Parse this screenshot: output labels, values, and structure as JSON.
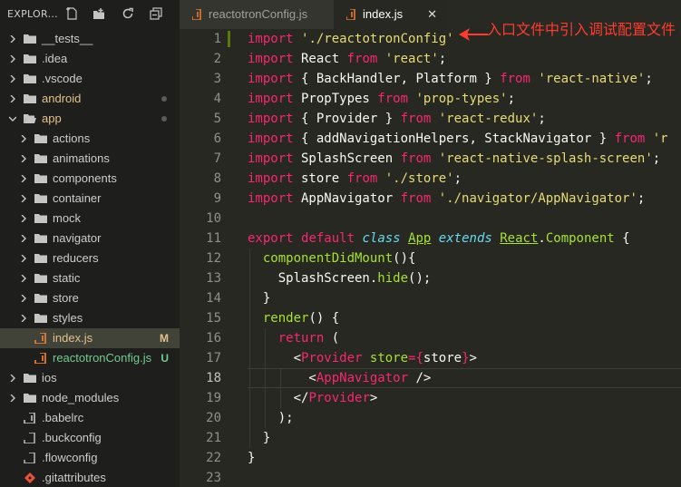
{
  "explorer": {
    "title": "EXPLOR...",
    "icons": [
      "new-file-icon",
      "new-folder-icon",
      "refresh-icon",
      "collapse-all-icon"
    ]
  },
  "tree": [
    {
      "label": "__tests__",
      "kind": "folder",
      "depth": 0,
      "expanded": false
    },
    {
      "label": ".idea",
      "kind": "folder",
      "depth": 0,
      "expanded": false
    },
    {
      "label": ".vscode",
      "kind": "folder",
      "depth": 0,
      "expanded": false
    },
    {
      "label": "android",
      "kind": "folder",
      "depth": 0,
      "expanded": false,
      "color": "orange",
      "dot": true
    },
    {
      "label": "app",
      "kind": "folder",
      "depth": 0,
      "expanded": true,
      "color": "orange",
      "dot": true
    },
    {
      "label": "actions",
      "kind": "folder",
      "depth": 1,
      "expanded": false
    },
    {
      "label": "animations",
      "kind": "folder",
      "depth": 1,
      "expanded": false
    },
    {
      "label": "components",
      "kind": "folder",
      "depth": 1,
      "expanded": false
    },
    {
      "label": "container",
      "kind": "folder",
      "depth": 1,
      "expanded": false
    },
    {
      "label": "mock",
      "kind": "folder",
      "depth": 1,
      "expanded": false
    },
    {
      "label": "navigator",
      "kind": "folder",
      "depth": 1,
      "expanded": false
    },
    {
      "label": "reducers",
      "kind": "folder",
      "depth": 1,
      "expanded": false
    },
    {
      "label": "static",
      "kind": "folder",
      "depth": 1,
      "expanded": false
    },
    {
      "label": "store",
      "kind": "folder",
      "depth": 1,
      "expanded": false
    },
    {
      "label": "styles",
      "kind": "folder",
      "depth": 1,
      "expanded": false
    },
    {
      "label": "index.js",
      "kind": "js",
      "depth": 1,
      "color": "orange",
      "status": "M",
      "selected": true
    },
    {
      "label": "reactotronConfig.js",
      "kind": "js",
      "depth": 1,
      "color": "green",
      "status": "U"
    },
    {
      "label": "ios",
      "kind": "folder",
      "depth": 0,
      "expanded": false
    },
    {
      "label": "node_modules",
      "kind": "folder",
      "depth": 0,
      "expanded": false
    },
    {
      "label": ".babelrc",
      "kind": "config",
      "depth": 0
    },
    {
      "label": ".buckconfig",
      "kind": "file",
      "depth": 0
    },
    {
      "label": ".flowconfig",
      "kind": "file",
      "depth": 0
    },
    {
      "label": ".gitattributes",
      "kind": "git",
      "depth": 0
    }
  ],
  "tabs": [
    {
      "label": "reactotronConfig.js",
      "active": false
    },
    {
      "label": "index.js",
      "active": true,
      "close": "✕"
    }
  ],
  "editor": {
    "current_line": 18,
    "lines": [
      [
        [
          "k",
          "import"
        ],
        [
          "p",
          " "
        ],
        [
          "s",
          "'./reactotronConfig'"
        ]
      ],
      [
        [
          "k",
          "import"
        ],
        [
          "p",
          " React "
        ],
        [
          "k",
          "from"
        ],
        [
          "p",
          " "
        ],
        [
          "s",
          "'react'"
        ],
        [
          "p",
          ";"
        ]
      ],
      [
        [
          "k",
          "import"
        ],
        [
          "p",
          " { BackHandler, Platform } "
        ],
        [
          "k",
          "from"
        ],
        [
          "p",
          " "
        ],
        [
          "s",
          "'react-native'"
        ],
        [
          "p",
          ";"
        ]
      ],
      [
        [
          "k",
          "import"
        ],
        [
          "p",
          " PropTypes "
        ],
        [
          "k",
          "from"
        ],
        [
          "p",
          " "
        ],
        [
          "s",
          "'prop-types'"
        ],
        [
          "p",
          ";"
        ]
      ],
      [
        [
          "k",
          "import"
        ],
        [
          "p",
          " { Provider } "
        ],
        [
          "k",
          "from"
        ],
        [
          "p",
          " "
        ],
        [
          "s",
          "'react-redux'"
        ],
        [
          "p",
          ";"
        ]
      ],
      [
        [
          "k",
          "import"
        ],
        [
          "p",
          " { addNavigationHelpers, StackNavigator } "
        ],
        [
          "k",
          "from"
        ],
        [
          "p",
          " "
        ],
        [
          "s",
          "'r"
        ]
      ],
      [
        [
          "k",
          "import"
        ],
        [
          "p",
          " SplashScreen "
        ],
        [
          "k",
          "from"
        ],
        [
          "p",
          " "
        ],
        [
          "s",
          "'react-native-splash-screen'"
        ],
        [
          "p",
          ";"
        ]
      ],
      [
        [
          "k",
          "import"
        ],
        [
          "p",
          " store "
        ],
        [
          "k",
          "from"
        ],
        [
          "p",
          " "
        ],
        [
          "s",
          "'./store'"
        ],
        [
          "p",
          ";"
        ]
      ],
      [
        [
          "k",
          "import"
        ],
        [
          "p",
          " AppNavigator "
        ],
        [
          "k",
          "from"
        ],
        [
          "p",
          " "
        ],
        [
          "s",
          "'./navigator/AppNavigator'"
        ],
        [
          "p",
          ";"
        ]
      ],
      [],
      [
        [
          "k",
          "export"
        ],
        [
          "p",
          " "
        ],
        [
          "k",
          "default"
        ],
        [
          "p",
          " "
        ],
        [
          "t",
          "class"
        ],
        [
          "p",
          " "
        ],
        [
          "cls",
          "App"
        ],
        [
          "p",
          " "
        ],
        [
          "t",
          "extends"
        ],
        [
          "p",
          " "
        ],
        [
          "cls",
          "React"
        ],
        [
          "p",
          "."
        ],
        [
          "f",
          "Component"
        ],
        [
          "p",
          " {"
        ]
      ],
      [
        [
          "p",
          "  "
        ],
        [
          "f",
          "componentDidMount"
        ],
        [
          "p",
          "(){"
        ]
      ],
      [
        [
          "p",
          "    SplashScreen."
        ],
        [
          "f",
          "hide"
        ],
        [
          "p",
          "();"
        ]
      ],
      [
        [
          "p",
          "  }"
        ]
      ],
      [
        [
          "p",
          "  "
        ],
        [
          "f",
          "render"
        ],
        [
          "p",
          "() {"
        ]
      ],
      [
        [
          "p",
          "    "
        ],
        [
          "k",
          "return"
        ],
        [
          "p",
          " ("
        ]
      ],
      [
        [
          "p",
          "      <"
        ],
        [
          "tag",
          "Provider"
        ],
        [
          "p",
          " "
        ],
        [
          "attr",
          "store"
        ],
        [
          "k",
          "="
        ],
        [
          "k",
          "{"
        ],
        [
          "p",
          "store"
        ],
        [
          "k",
          "}"
        ],
        [
          "p",
          ">"
        ]
      ],
      [
        [
          "p",
          "        <"
        ],
        [
          "tag",
          "AppNavigator"
        ],
        [
          "p",
          " />"
        ]
      ],
      [
        [
          "p",
          "      </"
        ],
        [
          "tag",
          "Provider"
        ],
        [
          "p",
          ">"
        ]
      ],
      [
        [
          "p",
          "    );"
        ]
      ],
      [
        [
          "p",
          "  }"
        ]
      ],
      [
        [
          "p",
          "}"
        ]
      ],
      []
    ]
  },
  "annotation": {
    "text": "入口文件中引入调试配置文件",
    "color": "#ff3b30"
  }
}
